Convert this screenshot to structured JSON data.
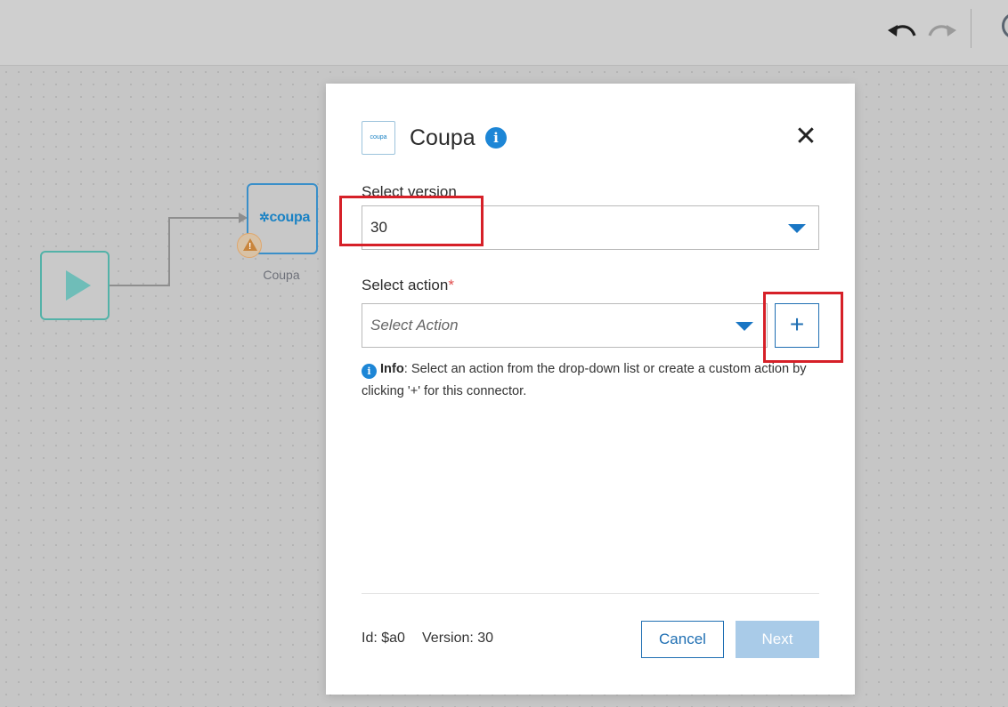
{
  "canvas": {
    "node_label": "Coupa",
    "node_logo_text": "coupa"
  },
  "modal": {
    "logo_text": "coupa",
    "title": "Coupa",
    "close_symbol": "✕",
    "version_label": "Select version",
    "version_value": "30",
    "action_label": "Select action",
    "action_required_mark": "*",
    "action_placeholder": "Select Action",
    "add_symbol": "+",
    "info_title": "Info",
    "info_text": ": Select an action from the drop-down list or create a custom action by clicking '+' for this connector.",
    "id_text": "Id: $a0",
    "version_text": "Version: 30",
    "cancel_label": "Cancel",
    "next_label": "Next"
  },
  "colors": {
    "accent": "#1f6fb3",
    "highlight": "#d62028",
    "next_disabled": "#a9cbe8",
    "start_node": "#53b2a8"
  },
  "icons": [
    "undo-icon",
    "redo-icon",
    "avatar",
    "play-icon",
    "warning-icon",
    "info-icon",
    "close-icon",
    "chevron-down-icon",
    "plus-icon"
  ]
}
